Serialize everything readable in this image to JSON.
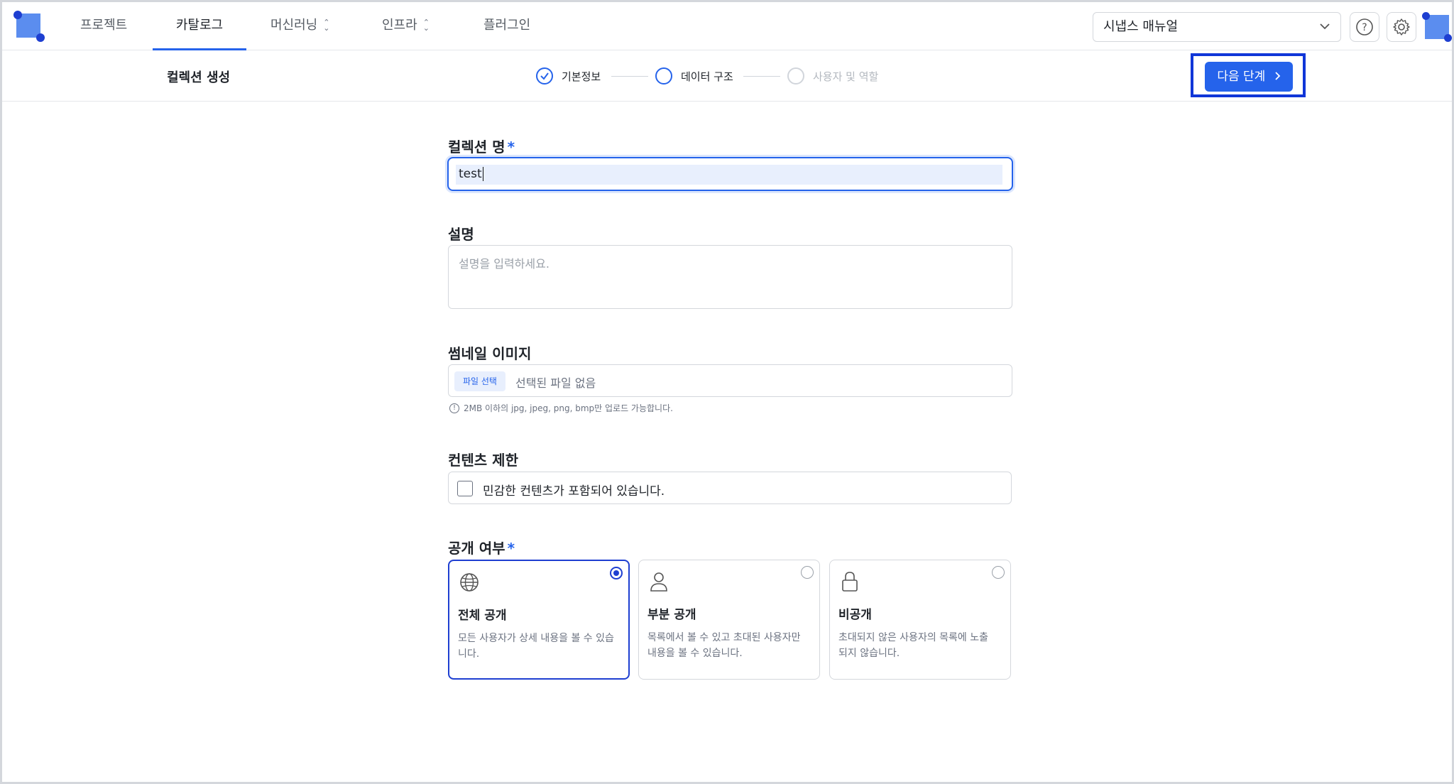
{
  "nav": {
    "items": [
      {
        "label": "프로젝트",
        "dropdown": false,
        "active": false
      },
      {
        "label": "카탈로그",
        "dropdown": false,
        "active": true
      },
      {
        "label": "머신러닝",
        "dropdown": true,
        "active": false
      },
      {
        "label": "인프라",
        "dropdown": true,
        "active": false
      },
      {
        "label": "플러그인",
        "dropdown": false,
        "active": false
      }
    ],
    "manual_select": "시냅스 매뉴얼"
  },
  "subheader": {
    "title": "컬렉션 생성",
    "steps": [
      {
        "label": "기본정보",
        "state": "done"
      },
      {
        "label": "데이터 구조",
        "state": "current"
      },
      {
        "label": "사용자 및 역할",
        "state": "pending"
      }
    ],
    "next_button": "다음 단계"
  },
  "form": {
    "name_label": "컬렉션 명",
    "name_value": "test",
    "description_label": "설명",
    "description_placeholder": "설명을 입력하세요.",
    "thumbnail_label": "썸네일 이미지",
    "file_button": "파일 선택",
    "file_none": "선택된 파일 없음",
    "file_hint": "2MB 이하의 jpg, jpeg, png, bmp만 업로드 가능합니다.",
    "content_label": "컨텐츠 제한",
    "content_check": "민감한 컨텐츠가 포함되어 있습니다.",
    "visibility_label": "공개 여부",
    "visibility_options": [
      {
        "title": "전체 공개",
        "desc": "모든 사용자가 상세 내용을 볼 수 있습니다.",
        "icon": "globe-icon",
        "selected": true
      },
      {
        "title": "부분 공개",
        "desc": "목록에서 볼 수 있고 초대된 사용자만 내용을 볼 수 있습니다.",
        "icon": "user-icon",
        "selected": false
      },
      {
        "title": "비공개",
        "desc": "초대되지 않은 사용자의 목록에 노출되지 않습니다.",
        "icon": "lock-icon",
        "selected": false
      }
    ]
  },
  "colors": {
    "accent": "#2563eb",
    "highlight_border": "#1036d8"
  }
}
